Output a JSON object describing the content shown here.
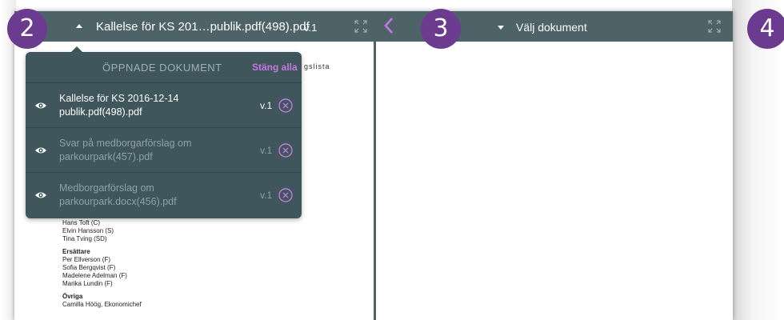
{
  "left_panel": {
    "document_title": "Kallelse för KS 201…publik.pdf(498).pdf",
    "version": "v.1",
    "step_number": "2"
  },
  "right_panel": {
    "choose_document": "Välj dokument",
    "step_number": "3"
  },
  "far_right": {
    "step_number": "4"
  },
  "dropdown": {
    "title": "ÖPPNADE DOKUMENT",
    "close_all": "Stäng alla",
    "items": [
      {
        "name_line1": "Kallelse för KS 2016-12-14",
        "name_line2": "publik.pdf(498).pdf",
        "version": "v.1",
        "active": true
      },
      {
        "name_line1": "Svar på medborgarförslag om",
        "name_line2": "parkourpark(457).pdf",
        "version": "v.1",
        "active": false
      },
      {
        "name_line1": "Medborgarförslag om",
        "name_line2": "parkourpark.docx(456).pdf",
        "version": "v.1",
        "active": false
      }
    ]
  },
  "pdf_content": {
    "partial_heading": "gslista",
    "members": [
      "Hans Toft (C)",
      "Elvin Hansson (S)",
      "Tina Tving (SD)"
    ],
    "substitutes_heading": "Ersättare",
    "substitutes": [
      "Per Ellverson (F)",
      "Sofia Bergqvist (F)",
      "Madelene Adelman (F)",
      "Marika Lundin (F)"
    ],
    "others_heading": "Övriga",
    "others": [
      "Camilla Höög, Ekonomichef"
    ]
  },
  "colors": {
    "toolbar": "#4e6368",
    "dropdown_bg": "#3f565c",
    "badge": "#6b3b8f",
    "accent_purple": "#c678e0"
  }
}
